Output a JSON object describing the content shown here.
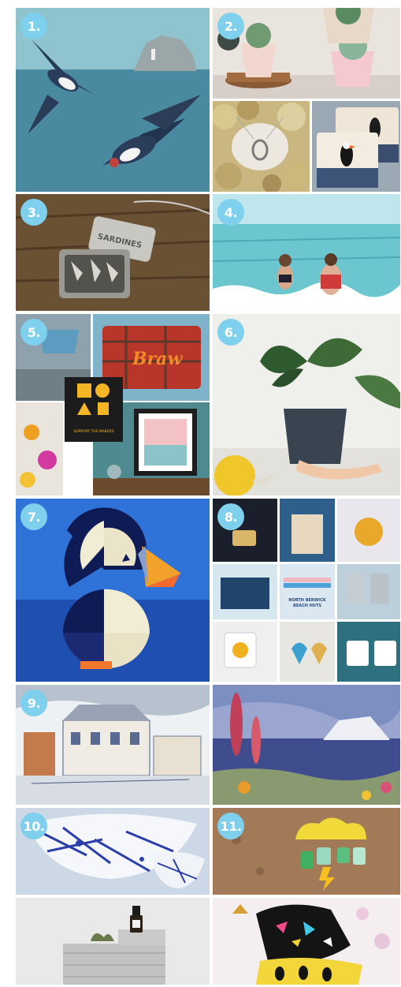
{
  "tiles": [
    {
      "id": "t1",
      "badge": "1.",
      "subject": "swallows-over-bass-rock-painting"
    },
    {
      "id": "t2a",
      "badge": "2.",
      "subject": "succulents-in-painted-pots"
    },
    {
      "id": "t2b",
      "badge": "",
      "subject": "silver-pendant-on-shells"
    },
    {
      "id": "t2c",
      "badge": "",
      "subject": "puffin-cushions"
    },
    {
      "id": "t3",
      "badge": "3.",
      "subject": "sardine-tin-pendant"
    },
    {
      "id": "t4",
      "badge": "4.",
      "subject": "sea-swimmers-illustration"
    },
    {
      "id": "t5",
      "badge": "5.",
      "subject": "support-the-makers-collage"
    },
    {
      "id": "t6",
      "badge": "6.",
      "subject": "potted-plant-in-hand"
    },
    {
      "id": "t7",
      "badge": "7.",
      "subject": "paper-puffin"
    },
    {
      "id": "t8",
      "badge": "8.",
      "subject": "north-berwick-gifts-collage"
    },
    {
      "id": "t9a",
      "badge": "9.",
      "subject": "seafront-houses-painting"
    },
    {
      "id": "t9b",
      "badge": "",
      "subject": "bass-rock-foxgloves-painting"
    },
    {
      "id": "t10",
      "badge": "10.",
      "subject": "splatter-bowls"
    },
    {
      "id": "t11",
      "badge": "11.",
      "subject": "cloud-earrings"
    },
    {
      "id": "t12",
      "badge": "",
      "subject": "skincare-dropper-bottle"
    },
    {
      "id": "t13",
      "badge": "",
      "subject": "puffin-print-face-masks"
    }
  ],
  "texts": {
    "sardines": "SARDINES",
    "braw": "Braw",
    "support": "SUPPORT THE MAKERS",
    "beach_huts_1": "NORTH BERWICK",
    "beach_huts_2": "BEACH HUTS"
  },
  "colors": {
    "badge": "#7fd0ec",
    "sea": "#3d7f93",
    "puffin_bg": "#2b5fc4",
    "tartan": "#c0392b"
  }
}
